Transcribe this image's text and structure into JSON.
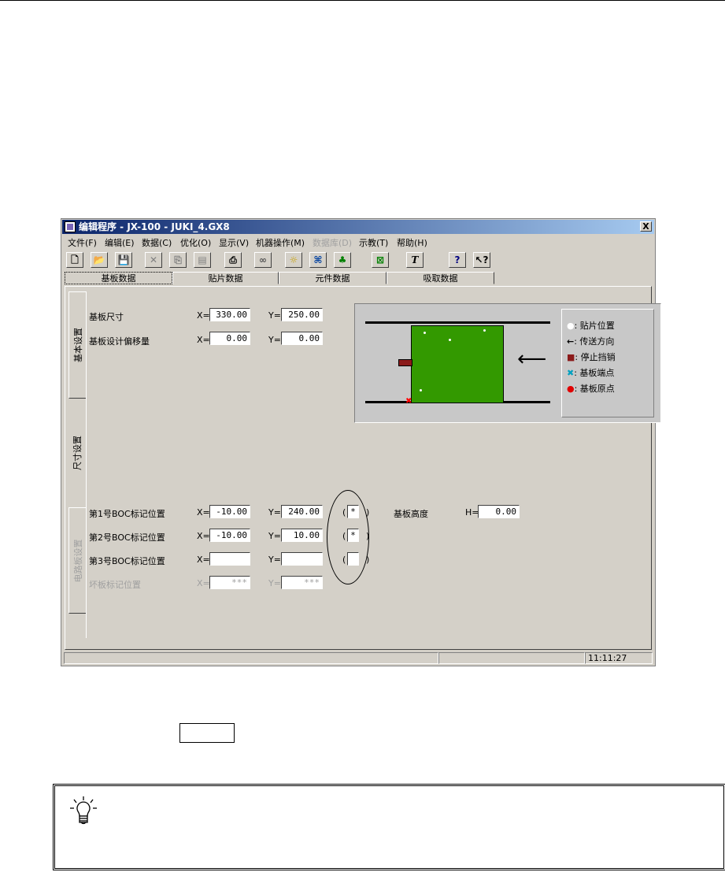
{
  "window": {
    "title": "编辑程序 - JX-100 - JUKI_4.GX8",
    "close_label": "X"
  },
  "menu": [
    "文件(F)",
    "编辑(E)",
    "数据(C)",
    "优化(O)",
    "显示(V)",
    "机器操作(M)",
    "数据库(D)",
    "示教(T)",
    "帮助(H)"
  ],
  "menu_disabled_index": 6,
  "toolbar": [
    "new-icon",
    "open-icon",
    "save-icon",
    "cut-icon",
    "copy-icon",
    "paste-icon",
    "print-icon",
    "binoculars-icon",
    "lightbulb-icon",
    "network-icon",
    "components-icon",
    "fit-icon",
    "text-tool-icon",
    "help-icon",
    "context-help-icon"
  ],
  "tabs": [
    "基板数据",
    "贴片数据",
    "元件数据",
    "吸取数据"
  ],
  "side_tabs": [
    "基本设置",
    "尺寸设置",
    "电路板设置"
  ],
  "fields": {
    "board_size_label": "基板尺寸",
    "board_size_x": "330.00",
    "board_size_y": "250.00",
    "design_offset_label": "基板设计偏移量",
    "design_offset_x": "0.00",
    "design_offset_y": "0.00",
    "boc1_label": "第1号BOC标记位置",
    "boc1_x": "-10.00",
    "boc1_y": "240.00",
    "boc1_flag": "*",
    "boc2_label": "第2号BOC标记位置",
    "boc2_x": "-10.00",
    "boc2_y": "10.00",
    "boc2_flag": "*",
    "boc3_label": "第3号BOC标记位置",
    "boc3_x": "",
    "boc3_y": "",
    "boc3_flag": "",
    "bad_mark_label": "坏板标记位置",
    "bad_mark_x": "***",
    "bad_mark_y": "***",
    "height_label": "基板高度",
    "height_value": "0.00",
    "x_eq": "X=",
    "y_eq": "Y=",
    "h_eq": "H="
  },
  "legend": [
    {
      "icon": "white-dot-icon",
      "text": ": 贴片位置"
    },
    {
      "icon": "arrow-left-icon",
      "text": ": 传送方向"
    },
    {
      "icon": "stopper-icon",
      "text": ": 停止挡销"
    },
    {
      "icon": "x-mark-icon",
      "text": ": 基板端点"
    },
    {
      "icon": "red-dot-icon",
      "text": ": 基板原点"
    }
  ],
  "statusbar": {
    "time": "11:11:27"
  },
  "colors": {
    "board": "#339900",
    "title_start": "#0a246a",
    "title_end": "#a6caf0"
  }
}
